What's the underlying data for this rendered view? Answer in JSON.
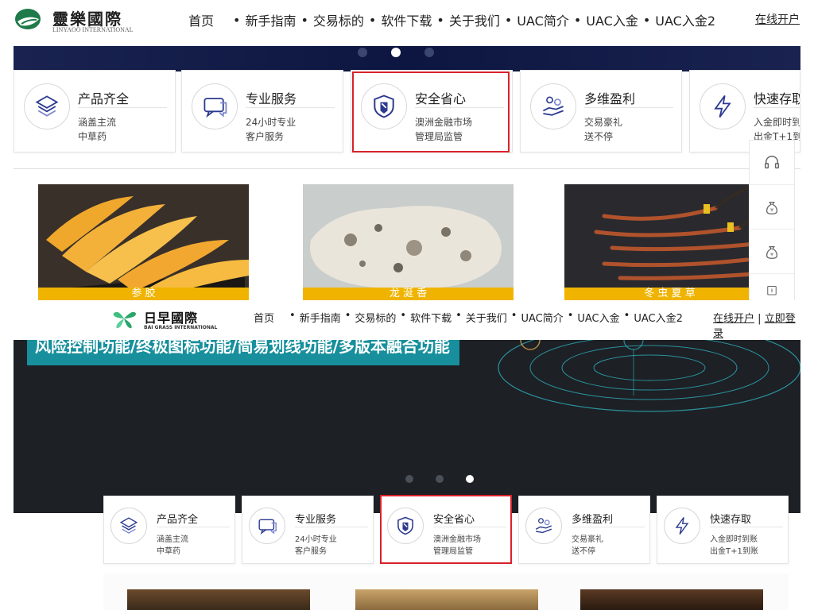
{
  "top": {
    "logo_text": "靈樂國際",
    "logo_sub": "LINYAOO INTERNATIONAL",
    "nav": [
      "首页",
      "新手指南",
      "交易标的",
      "软件下载",
      "关于我们",
      "UAC简介",
      "UAC入金",
      "UAC入金2"
    ],
    "nav_separator": "•",
    "open_account": "在线开户",
    "features": [
      {
        "title": "产品齐全",
        "line1": "涵盖主流",
        "line2": "中草药",
        "icon": "layers-icon"
      },
      {
        "title": "专业服务",
        "line1": "24小时专业",
        "line2": "客户服务",
        "icon": "chat-icon"
      },
      {
        "title": "安全省心",
        "line1": "澳洲金融市场",
        "line2": "管理局监管",
        "icon": "shield-icon"
      },
      {
        "title": "多维盈利",
        "line1": "交易豪礼",
        "line2": "送不停",
        "icon": "hand-coins-icon"
      },
      {
        "title": "快速存取",
        "line1": "入金即时到",
        "line2": "出金T+1到",
        "icon": "lightning-icon"
      }
    ],
    "products": [
      {
        "caption": "参  胶"
      },
      {
        "caption": "龙  涎  香"
      },
      {
        "caption": "冬  虫  夏  草"
      }
    ],
    "side_tools": [
      "headset-icon",
      "money-bag-icon",
      "money-bag-icon",
      "arrow-up-icon"
    ]
  },
  "bottom": {
    "logo_text": "日早國際",
    "logo_sub": "BAI GRASS INTERNATIONAL",
    "nav": [
      "首页",
      "新手指南",
      "交易标的",
      "软件下载",
      "关于我们",
      "UAC简介",
      "UAC入金",
      "UAC入金2"
    ],
    "nav_separator": "•",
    "open_account": "在线开户",
    "login": "立即登录",
    "banner_title": "风险控制功能/终极图标功能/简易划线功能/多版本融合功能",
    "features": [
      {
        "title": "产品齐全",
        "line1": "涵盖主流",
        "line2": "中草药",
        "icon": "layers-icon"
      },
      {
        "title": "专业服务",
        "line1": "24小时专业",
        "line2": "客户服务",
        "icon": "chat-icon"
      },
      {
        "title": "安全省心",
        "line1": "澳洲金融市场",
        "line2": "管理局监管",
        "icon": "shield-icon"
      },
      {
        "title": "多维盈利",
        "line1": "交易豪礼",
        "line2": "送不停",
        "icon": "hand-coins-icon"
      },
      {
        "title": "快速存取",
        "line1": "入金即时到账",
        "line2": "出金T+1到账",
        "icon": "lightning-icon"
      }
    ]
  },
  "colors": {
    "accent_yellow": "#f0b400",
    "highlight_red": "#d8222b",
    "icon_blue": "#2b3a8f",
    "teal_banner": "#178f9c",
    "nav_underline": "#e5a100"
  }
}
